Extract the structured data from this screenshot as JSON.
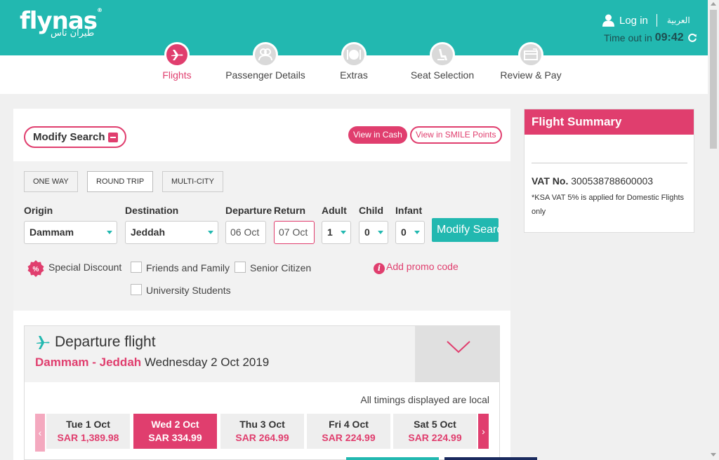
{
  "header": {
    "logo": "flynas",
    "logo_arabic": "طيران ناس",
    "login_label": "Log in",
    "language_label": "العربية",
    "timeout_label": "Time out in",
    "timeout_value": "09:42"
  },
  "steps": [
    {
      "label": "Flights",
      "active": true,
      "icon": "plane-icon"
    },
    {
      "label": "Passenger Details",
      "active": false,
      "icon": "passengers-icon"
    },
    {
      "label": "Extras",
      "active": false,
      "icon": "meal-icon"
    },
    {
      "label": "Seat Selection",
      "active": false,
      "icon": "seat-icon"
    },
    {
      "label": "Review & Pay",
      "active": false,
      "icon": "payment-icon"
    }
  ],
  "search": {
    "modify_label": "Modify Search",
    "view_cash_label": "View in Cash",
    "view_smile_label": "View in SMILE Points",
    "trip_types": [
      "ONE WAY",
      "ROUND TRIP",
      "MULTI-CITY"
    ],
    "selected_trip_type": "ROUND TRIP",
    "labels": {
      "origin": "Origin",
      "destination": "Destination",
      "departure": "Departure",
      "return": "Return",
      "adult": "Adult",
      "child": "Child",
      "infant": "Infant"
    },
    "values": {
      "origin": "Dammam",
      "destination": "Jeddah",
      "departure": "06 Oct",
      "return": "07 Oct",
      "adult": "1",
      "child": "0",
      "infant": "0"
    },
    "submit_label": "Modify Search",
    "special_discount_label": "Special Discount",
    "discounts": [
      "Friends and Family",
      "Senior Citizen",
      "University Students"
    ],
    "promo_label": "Add promo code"
  },
  "departure": {
    "title": "Departure flight",
    "route": "Dammam - Jeddah",
    "date": "Wednesday 2 Oct 2019",
    "timings_note": "All timings displayed are local",
    "dates": [
      {
        "day": "Tue 1 Oct",
        "price": "SAR 1,389.98",
        "active": false
      },
      {
        "day": "Wed 2 Oct",
        "price": "SAR 334.99",
        "active": true
      },
      {
        "day": "Thu 3 Oct",
        "price": "SAR 264.99",
        "active": false
      },
      {
        "day": "Fri 4 Oct",
        "price": "SAR 224.99",
        "active": false
      },
      {
        "day": "Sat 5 Oct",
        "price": "SAR 224.99",
        "active": false
      }
    ]
  },
  "summary": {
    "title": "Flight Summary",
    "vat_label": "VAT No.",
    "vat_number": "300538788600003",
    "vat_note": "*KSA VAT 5% is applied for Domestic Flights only"
  },
  "colors": {
    "teal": "#22b8b0",
    "pink": "#e03e6e",
    "navy": "#1a2a5e"
  }
}
